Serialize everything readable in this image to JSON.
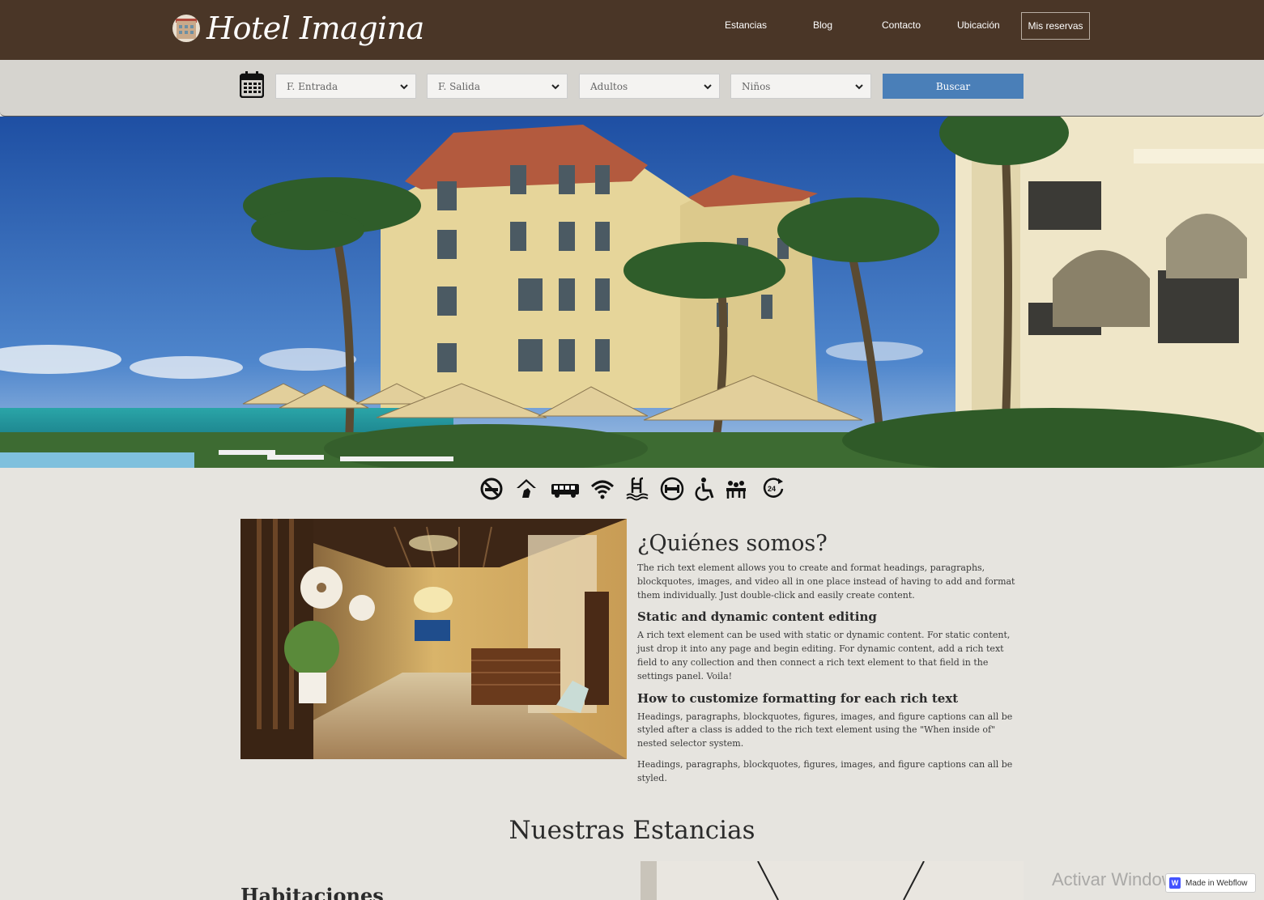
{
  "brand": {
    "name": "Hotel Imagina"
  },
  "nav": {
    "links": [
      "Estancias",
      "Blog",
      "Contacto",
      "Ubicación"
    ],
    "cta": "Mis reservas"
  },
  "search": {
    "checkin": "F. Entrada",
    "checkout": "F. Salida",
    "adults": "Adultos",
    "children": "Niños",
    "button": "Buscar"
  },
  "amenities": [
    "no-smoking-icon",
    "pets-icon",
    "shuttle-bus-icon",
    "wifi-icon",
    "pool-icon",
    "gym-icon",
    "accessible-icon",
    "meeting-icon",
    "24h-service-icon"
  ],
  "about": {
    "title": "¿Quiénes somos?",
    "p1": "The rich text element allows you to create and format headings, paragraphs, blockquotes, images, and video all in one place instead of having to add and format them individually. Just double-click and easily create content.",
    "h2": "Static and dynamic content editing",
    "p2": "A rich text element can be used with static or dynamic content. For static content, just drop it into any page and begin editing. For dynamic content, add a rich text field to any collection and then connect a rich text element to that field in the settings panel. Voila!",
    "h3": "How to customize formatting for each rich text",
    "p3": "Headings, paragraphs, blockquotes, figures, images, and figure captions can all be styled after a class is added to the rich text element using the \"When inside of\" nested selector system.",
    "p4": "Headings, paragraphs, blockquotes, figures, images, and figure captions can all be styled."
  },
  "stays": {
    "title": "Nuestras Estancias",
    "first": "Habitaciones"
  },
  "overlay": {
    "windows": "Activar Windows",
    "webflow": "Made in Webflow"
  },
  "colors": {
    "nav_bg": "#4a3627",
    "page_bg": "#e6e4df",
    "button": "#4a7fb8"
  }
}
